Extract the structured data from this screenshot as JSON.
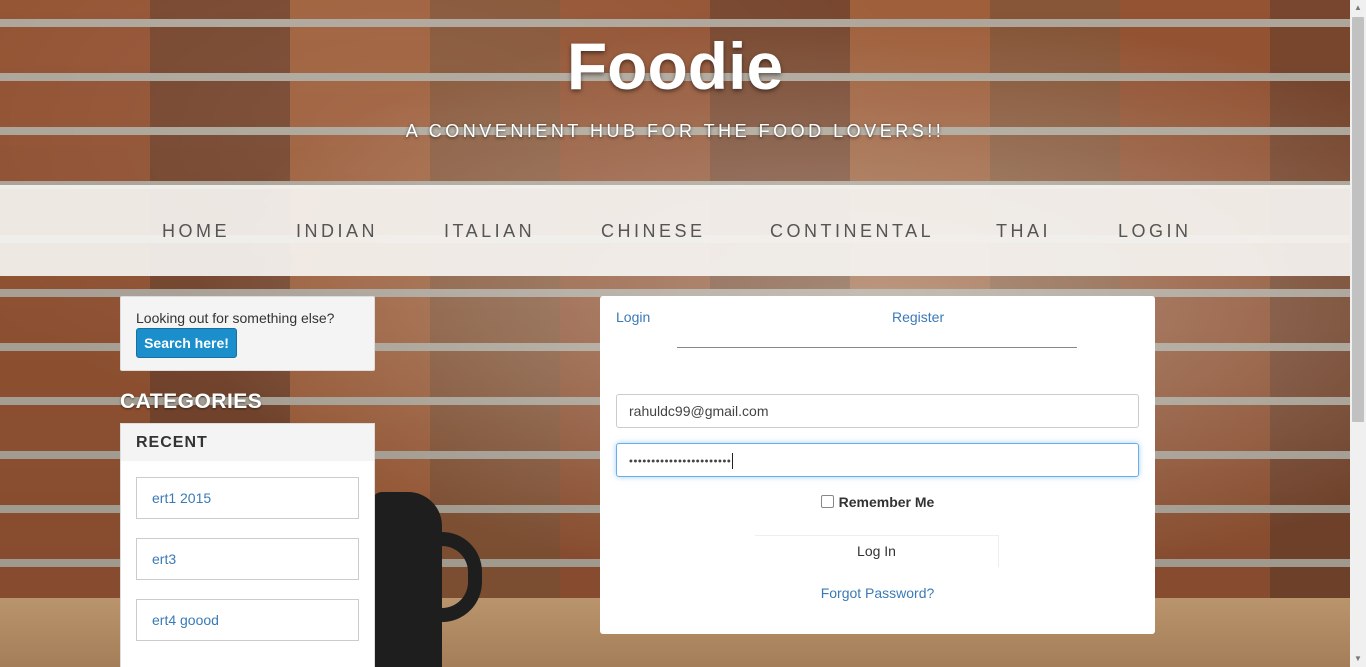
{
  "header": {
    "title": "Foodie",
    "tagline": "A CONVENIENT HUB FOR THE FOOD LOVERS!!"
  },
  "nav": {
    "items": [
      {
        "label": "HOME"
      },
      {
        "label": "INDIAN"
      },
      {
        "label": "ITALIAN"
      },
      {
        "label": "CHINESE"
      },
      {
        "label": "CONTINENTAL"
      },
      {
        "label": "THAI"
      },
      {
        "label": "LOGIN"
      }
    ]
  },
  "sidebar": {
    "search_prompt": "Looking out for something else?",
    "search_button": "Search here!",
    "categories_heading": "CATEGORIES",
    "recent_heading": "RECENT",
    "recent_items": [
      {
        "label": "ert1 2015"
      },
      {
        "label": "ert3"
      },
      {
        "label": "ert4 goood"
      }
    ]
  },
  "login": {
    "tabs": [
      {
        "label": "Login"
      },
      {
        "label": "Register"
      }
    ],
    "email_value": "rahuldc99@gmail.com",
    "password_mask": "•••••••••••••••••••••••",
    "remember_label": "Remember Me",
    "submit_label": "Log In",
    "forgot_label": "Forgot Password?"
  },
  "colors": {
    "link": "#3a7ab8",
    "search_button": "#1a8fcb",
    "focus_ring": "#66afe9"
  },
  "icons": {
    "scroll_up": "triangle-up-icon",
    "scroll_down": "triangle-down-icon"
  }
}
